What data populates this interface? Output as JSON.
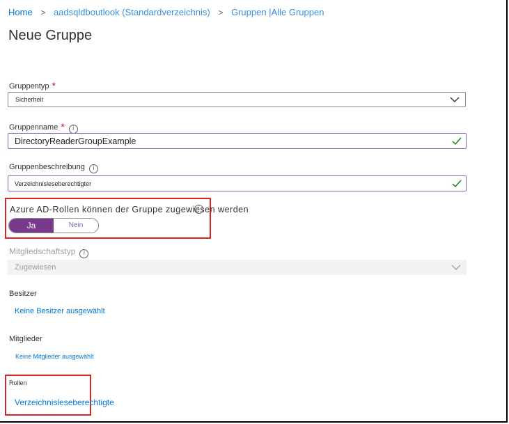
{
  "breadcrumb": {
    "items": [
      "Home",
      "aadsqldboutlook (Standardverzeichnis)",
      "Gruppen |Alle Gruppen"
    ],
    "separator": ">"
  },
  "page_title": "Neue Gruppe",
  "form": {
    "group_type": {
      "label": "Gruppentyp",
      "required_mark": "*",
      "value": "Sicherheit"
    },
    "group_name": {
      "label": "Gruppenname",
      "required_mark": "*",
      "value": "DirectoryReaderGroupExample"
    },
    "group_description": {
      "label": "Gruppenbeschreibung",
      "value": "Verzeichnisleseberechtigter"
    },
    "azure_ad_roles": {
      "label": "Azure AD-Rollen können der Gruppe zugewiesen werden",
      "yes": "Ja",
      "no": "Nein",
      "selected": "Ja"
    },
    "membership_type": {
      "label": "Mitgliedschaftstyp",
      "value": "Zugewiesen"
    },
    "owners": {
      "label": "Besitzer",
      "link": "Keine Besitzer ausgewählt"
    },
    "members": {
      "label": "Mitglieder",
      "link": "Keine Mitglieder ausgewählt"
    },
    "roles": {
      "label": "Rollen",
      "link": "Verzeichnisleseberechtigte"
    }
  },
  "colors": {
    "accent": "#0078d4",
    "toggle_on": "#773a8a",
    "required": "#c50f1f",
    "valid_check": "#107c10",
    "highlight_box": "#d92424"
  }
}
